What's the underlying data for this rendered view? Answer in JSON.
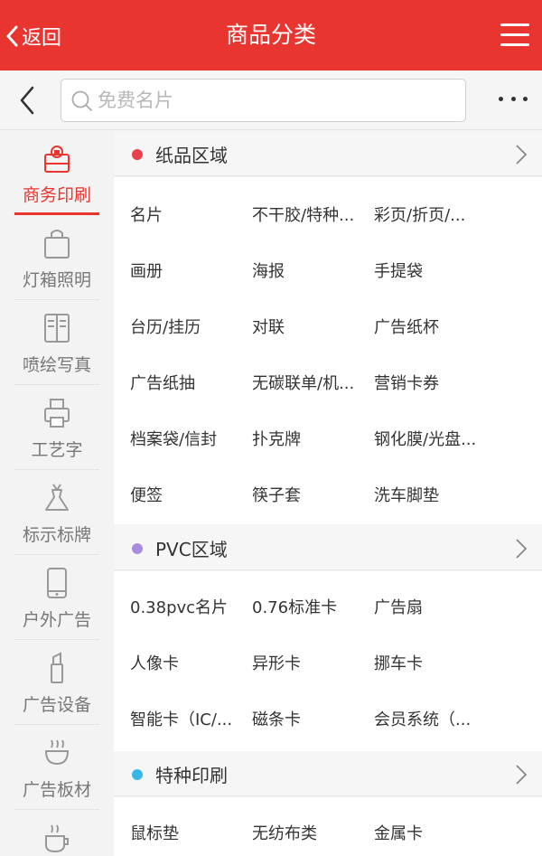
{
  "header": {
    "back_label": "返回",
    "title": "商品分类"
  },
  "search": {
    "placeholder": "免费名片"
  },
  "sidebar": {
    "items": [
      {
        "label": "商务印刷",
        "icon": "print-bag-icon",
        "active": true
      },
      {
        "label": "灯箱照明",
        "icon": "bag-icon"
      },
      {
        "label": "喷绘写真",
        "icon": "panel-icon"
      },
      {
        "label": "工艺字",
        "icon": "printer-icon"
      },
      {
        "label": "标示标牌",
        "icon": "dress-icon"
      },
      {
        "label": "户外广告",
        "icon": "phone-icon"
      },
      {
        "label": "广告设备",
        "icon": "lipstick-icon"
      },
      {
        "label": "广告板材",
        "icon": "bowl-icon"
      },
      {
        "label": "",
        "icon": "cup-icon"
      }
    ]
  },
  "colors": {
    "accent": "#e8352f",
    "dot_paper": "#e8414d",
    "dot_pvc": "#a98be0",
    "dot_special": "#37b7e6"
  },
  "sections": [
    {
      "name": "纸品区域",
      "items": [
        "名片",
        "不干胶/特种...",
        "彩页/折页/...",
        "画册",
        "海报",
        "手提袋",
        "台历/挂历",
        "对联",
        "广告纸杯",
        "广告纸抽",
        "无碳联单/机...",
        "营销卡券",
        "档案袋/信封",
        "扑克牌",
        "钢化膜/光盘...",
        "便签",
        "筷子套",
        "洗车脚垫"
      ]
    },
    {
      "name": "PVC区域",
      "items": [
        "0.38pvc名片",
        "0.76标准卡",
        "广告扇",
        "人像卡",
        "异形卡",
        "挪车卡",
        "智能卡（IC/...",
        "磁条卡",
        "会员系统（..."
      ]
    },
    {
      "name": "特种印刷",
      "items": [
        "鼠标垫",
        "无纺布类",
        "金属卡"
      ]
    }
  ]
}
